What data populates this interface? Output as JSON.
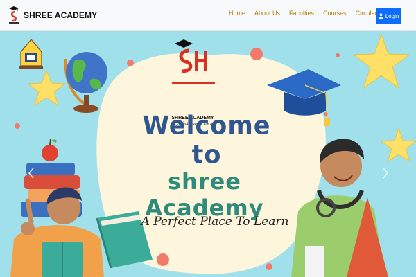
{
  "navbar": {
    "brand_name": "SHREE ACADEMY",
    "links": [
      {
        "label": "Home"
      },
      {
        "label": "About Us"
      },
      {
        "label": "Faculties"
      },
      {
        "label": "Courses"
      },
      {
        "label": "Circulars"
      }
    ],
    "login_label": "Login",
    "link_color": "#b87b00",
    "login_color": "#0d6efd"
  },
  "hero": {
    "logo_title": "SHREE ACADEMY",
    "logo_tagline": "A perfect place to learn",
    "heading_line1": "Welcome to",
    "heading_line2": "shree Academy",
    "tagline": "A Perfect Place To Learn",
    "background_color": "#9fe0ea",
    "heading1_color": "#2f568f",
    "heading2_color": "#2e8a7a"
  },
  "icons": [
    "graduation-cap-icon",
    "globe-icon",
    "star-icon",
    "book-icon",
    "apple-icon",
    "user-icon",
    "chevron-left-icon",
    "chevron-right-icon",
    "caret-down-icon"
  ]
}
